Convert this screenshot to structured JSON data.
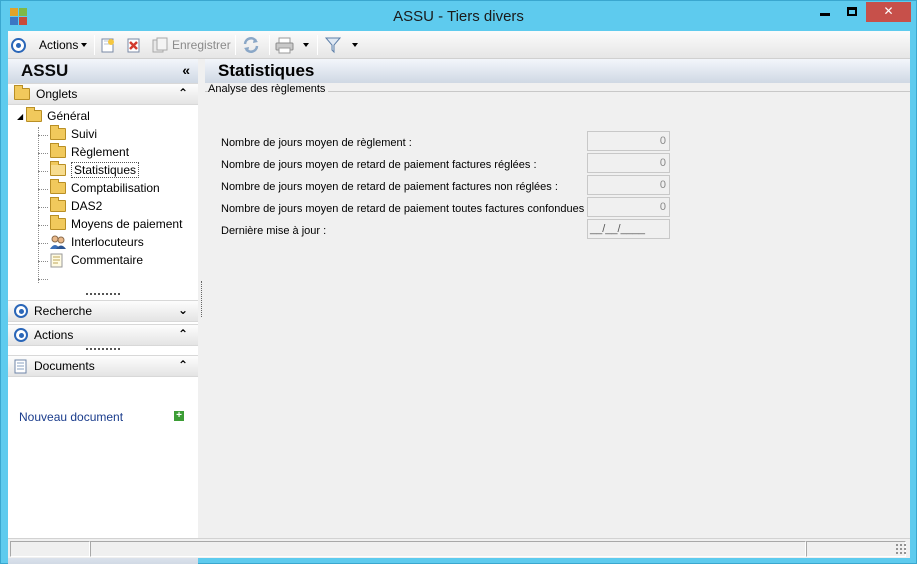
{
  "window": {
    "title": "ASSU -  Tiers divers",
    "controls": {
      "minimize": "minimize",
      "maximize": "maximize",
      "close": "✕"
    }
  },
  "toolbar": {
    "actions_label": "Actions",
    "save_label": "Enregistrer"
  },
  "left_panel": {
    "title": "ASSU",
    "collapse_glyph": "«",
    "sections": {
      "onglets": "Onglets",
      "recherche": "Recherche",
      "actions": "Actions",
      "documents": "Documents"
    },
    "tree": {
      "root": "Général",
      "items": [
        {
          "label": "Suivi",
          "icon": "folder-icon"
        },
        {
          "label": "Règlement",
          "icon": "folder-icon"
        },
        {
          "label": "Statistiques",
          "icon": "open-folder-icon",
          "selected": true
        },
        {
          "label": "Comptabilisation",
          "icon": "folder-icon"
        },
        {
          "label": "DAS2",
          "icon": "folder-icon"
        },
        {
          "label": "Moyens de paiement",
          "icon": "folder-icon"
        },
        {
          "label": "Interlocuteurs",
          "icon": "people-icon"
        },
        {
          "label": "Commentaire",
          "icon": "note-icon"
        }
      ]
    },
    "documents": {
      "new_document": "Nouveau document"
    }
  },
  "main": {
    "title": "Statistiques",
    "group_label": "Analyse des règlements",
    "fields": [
      {
        "label": "Nombre de jours moyen de règlement :",
        "value": "0"
      },
      {
        "label": "Nombre de jours moyen de retard de paiement factures réglées :",
        "value": "0"
      },
      {
        "label": "Nombre de jours moyen de retard de paiement factures non réglées :",
        "value": "0"
      },
      {
        "label": "Nombre de jours moyen de retard de paiement toutes factures confondues :",
        "value": "0"
      },
      {
        "label": "Dernière mise à jour :",
        "value": "__/__/____"
      }
    ]
  },
  "colors": {
    "title_bar": "#5ecbee",
    "close_button": "#c7504a",
    "accent_blue": "#2a66b8",
    "link": "#1a3c8c"
  }
}
